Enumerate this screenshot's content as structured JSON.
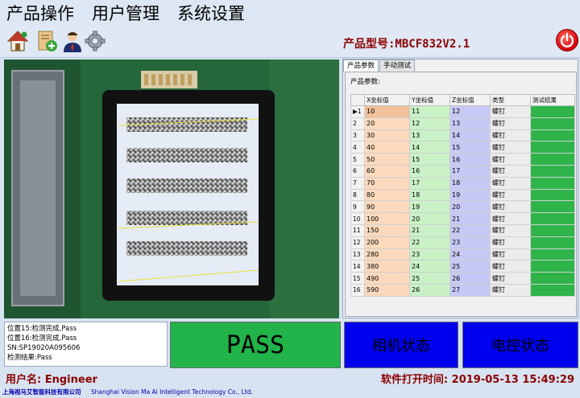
{
  "menu": [
    "产品操作",
    "用户管理",
    "系统设置"
  ],
  "toolbar": {
    "icons": [
      "home-icon",
      "document-add-icon",
      "user-engineer-icon",
      "gear-icon"
    ]
  },
  "model": {
    "label": "产品型号:MBCF832V2.1"
  },
  "colors": {
    "accent_text": "#8b0000",
    "pass_green": "#22b34a",
    "status_blue": "#0000ee",
    "x_col": "#fbd9bc",
    "y_col": "#c9f1c5",
    "z_col": "#c6c8f5",
    "result_col": "#2fb44a"
  },
  "tabs": [
    "产品参数",
    "手动测试"
  ],
  "params": {
    "group_title": "产品参数:",
    "columns": [
      "X坐标值",
      "Y坐标值",
      "Z坐标值",
      "类型",
      "测试结果"
    ],
    "rows": [
      {
        "n": "1",
        "x": "10",
        "y": "11",
        "z": "12",
        "type": "螺钉"
      },
      {
        "n": "2",
        "x": "20",
        "y": "12",
        "z": "13",
        "type": "螺钉"
      },
      {
        "n": "3",
        "x": "30",
        "y": "13",
        "z": "14",
        "type": "螺钉"
      },
      {
        "n": "4",
        "x": "40",
        "y": "14",
        "z": "15",
        "type": "螺钉"
      },
      {
        "n": "5",
        "x": "50",
        "y": "15",
        "z": "16",
        "type": "螺钉"
      },
      {
        "n": "6",
        "x": "60",
        "y": "16",
        "z": "17",
        "type": "螺钉"
      },
      {
        "n": "7",
        "x": "70",
        "y": "17",
        "z": "18",
        "type": "螺钉"
      },
      {
        "n": "8",
        "x": "80",
        "y": "18",
        "z": "19",
        "type": "螺钉"
      },
      {
        "n": "9",
        "x": "90",
        "y": "19",
        "z": "20",
        "type": "螺钉"
      },
      {
        "n": "10",
        "x": "100",
        "y": "20",
        "z": "21",
        "type": "螺钉"
      },
      {
        "n": "11",
        "x": "150",
        "y": "21",
        "z": "22",
        "type": "螺钉"
      },
      {
        "n": "12",
        "x": "200",
        "y": "22",
        "z": "23",
        "type": "螺钉"
      },
      {
        "n": "13",
        "x": "280",
        "y": "23",
        "z": "24",
        "type": "螺钉"
      },
      {
        "n": "14",
        "x": "380",
        "y": "24",
        "z": "25",
        "type": "螺钉"
      },
      {
        "n": "15",
        "x": "490",
        "y": "25",
        "z": "26",
        "type": "螺钉"
      },
      {
        "n": "16",
        "x": "590",
        "y": "26",
        "z": "27",
        "type": "螺钉"
      }
    ]
  },
  "log": [
    "位置15:检测完成,Pass",
    "位置16:检测完成,Pass",
    "SN:SP19020A095606",
    "检测结果:Pass"
  ],
  "status": {
    "pass": "PASS",
    "camera": "相机状态",
    "motion": "电控状态"
  },
  "footer": {
    "user": "用户名: Engineer",
    "open_time": "软件打开时间: 2019-05-13 15:49:29",
    "company_cn": "上海视马艾智能科技有限公司",
    "company_en": "Shanghai Vision Ma Ai Intelligent Technology Co., Ltd."
  }
}
